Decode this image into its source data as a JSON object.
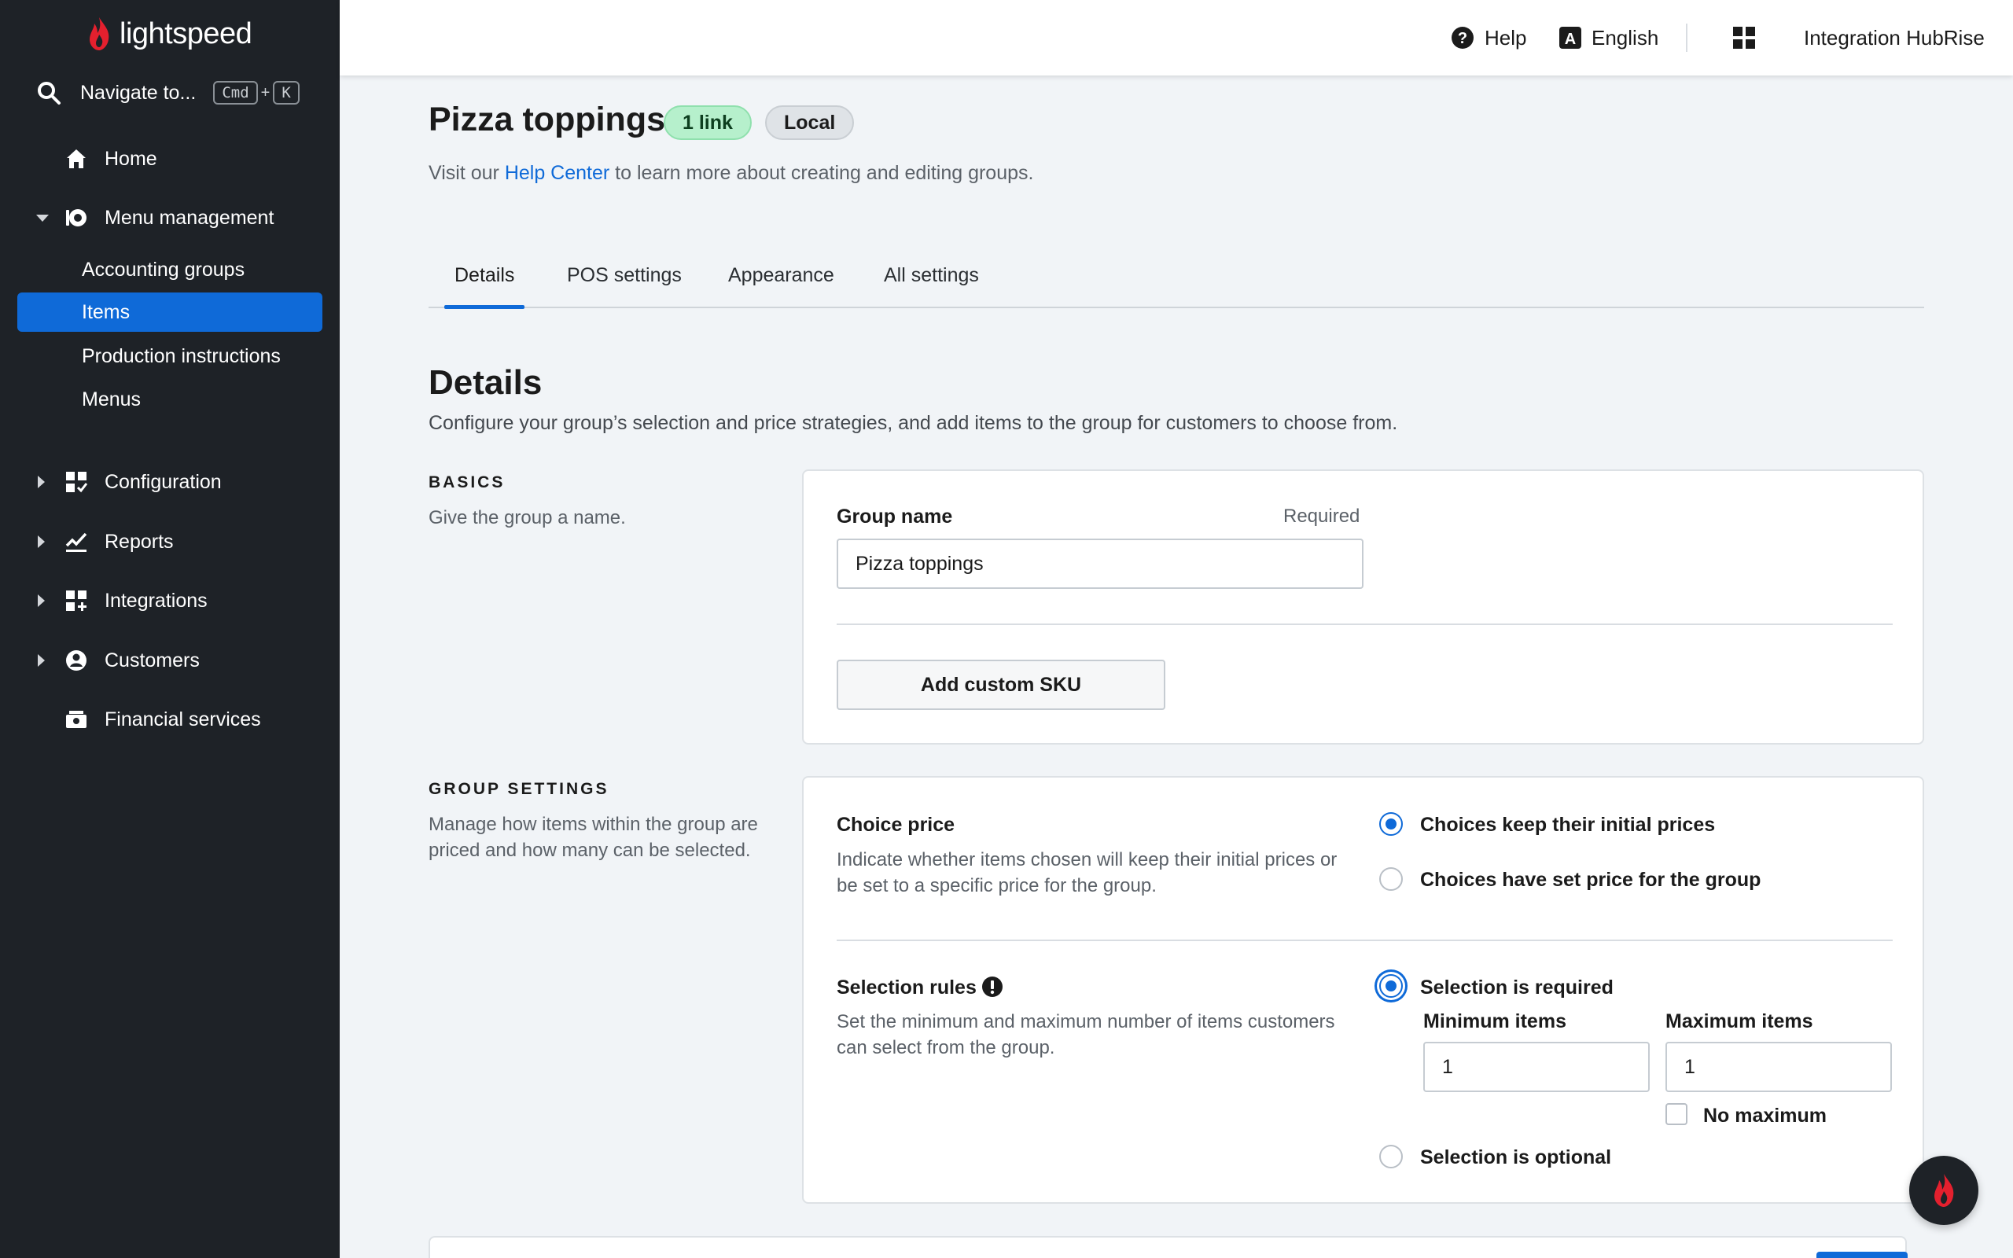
{
  "brand": {
    "name": "lightspeed"
  },
  "navigate": {
    "label": "Navigate to...",
    "key1": "Cmd",
    "plus": "+",
    "key2": "K"
  },
  "sidebar": {
    "home": "Home",
    "menu_management": "Menu management",
    "sub": [
      "Accounting groups",
      "Items",
      "Production instructions",
      "Menus"
    ],
    "configuration": "Configuration",
    "reports": "Reports",
    "integrations": "Integrations",
    "customers": "Customers",
    "financial": "Financial services"
  },
  "topbar": {
    "help": "Help",
    "language": "English",
    "account": "Integration HubRise"
  },
  "page": {
    "title": "Pizza toppings",
    "badge_link": "1 link",
    "badge_local": "Local",
    "subtitle_pre": "Visit our ",
    "subtitle_link": "Help Center",
    "subtitle_post": " to learn more about creating and editing groups."
  },
  "tabs": [
    "Details",
    "POS settings",
    "Appearance",
    "All settings"
  ],
  "details": {
    "title": "Details",
    "desc": "Configure your group’s selection and price strategies, and add items to the group for customers to choose from."
  },
  "basics": {
    "label": "BASICS",
    "desc": "Give the group a name.",
    "group_name_label": "Group name",
    "required": "Required",
    "group_name_value": "Pizza toppings",
    "add_sku": "Add custom SKU"
  },
  "group_settings": {
    "label": "GROUP SETTINGS",
    "desc": "Manage how items within the group are priced and how many can be selected.",
    "choice_price_label": "Choice price",
    "choice_price_desc": "Indicate whether items chosen will keep their initial prices or be set to a specific price for the group.",
    "opt_keep": "Choices keep their initial prices",
    "opt_set": "Choices have set price for the group",
    "selection_rules_label": "Selection rules",
    "selection_rules_desc": "Set the minimum and maximum number of items customers can select from the group.",
    "opt_required": "Selection is required",
    "min_label": "Minimum items",
    "max_label": "Maximum items",
    "min_value": "1",
    "max_value": "1",
    "no_max": "No maximum",
    "opt_optional": "Selection is optional"
  },
  "colors": {
    "accent": "#0f6ad8",
    "sidebar_bg": "#1e2227",
    "brand_red": "#e4202e",
    "badge_green": "#b6f0cc"
  }
}
